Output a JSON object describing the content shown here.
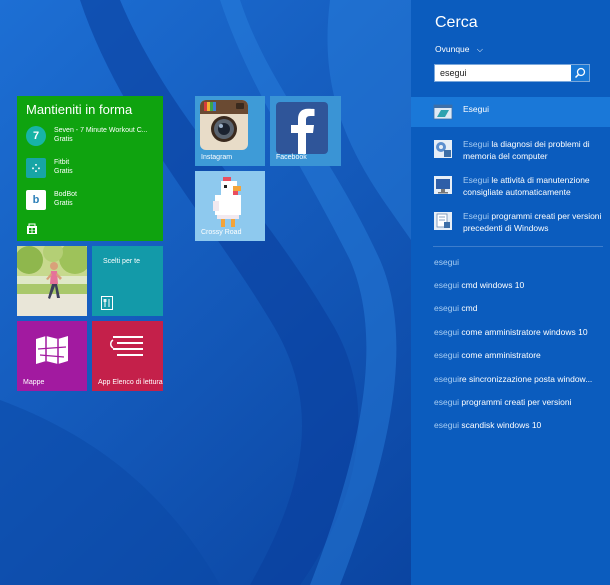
{
  "tiles": {
    "fitness": {
      "title": "Mantieniti in forma",
      "apps": [
        {
          "icon": "seven-icon",
          "glyph": "7",
          "name": "Seven - 7 Minute Workout C...",
          "price": "Gratis"
        },
        {
          "icon": "fitbit-icon",
          "glyph": "⁘",
          "name": "Fitbit",
          "price": "Gratis"
        },
        {
          "icon": "bodbot-icon",
          "glyph": "b",
          "name": "BodBot",
          "price": "Gratis"
        }
      ]
    },
    "scelti": {
      "label": "Scelti per te"
    },
    "mappe": {
      "label": "Mappe"
    },
    "app_lettura": {
      "label": "App Elenco di lettura"
    },
    "instagram": {
      "label": "Instagram"
    },
    "facebook": {
      "label": "Facebook"
    },
    "crossy": {
      "label": "Crossy Road"
    }
  },
  "panel": {
    "title": "Cerca",
    "scope": "Ovunque",
    "scope_chevron": "⌵",
    "search_value": "esegui",
    "results": [
      {
        "icon": "run-dialog-icon",
        "hl": "Esegui",
        "rest": ""
      },
      {
        "icon": "troubleshoot-icon",
        "hl": "Esegui",
        "rest": " la diagnosi dei problemi di memoria del computer"
      },
      {
        "icon": "maintenance-icon",
        "hl": "Esegui",
        "rest": " le attività di manutenzione consigliate automaticamente"
      },
      {
        "icon": "compatibility-icon",
        "hl": "Esegui",
        "rest": " programmi creati per versioni precedenti di Windows"
      }
    ],
    "suggestions": [
      {
        "a": "esegui",
        "b": ""
      },
      {
        "a": "esegui",
        "b": " cmd windows 10"
      },
      {
        "a": "esegui",
        "b": " cmd"
      },
      {
        "a": "esegui",
        "b": " come amministratore windows 10"
      },
      {
        "a": "esegui",
        "b": " come amministratore"
      },
      {
        "a": "esegui",
        "b": "re sincronizzazione posta window..."
      },
      {
        "a": "esegui",
        "b": " programmi creati per versioni"
      },
      {
        "a": "esegui",
        "b": " scandisk windows 10"
      }
    ]
  },
  "colors": {
    "background": "#0a4fb0",
    "panel": "#0b5cbe",
    "selected_result": "#1a78d8",
    "fitness_tile": "#0fa30f",
    "scelti_tile": "#139aa9",
    "mappe_tile": "#a21aa0",
    "app_tile": "#c4204a"
  }
}
